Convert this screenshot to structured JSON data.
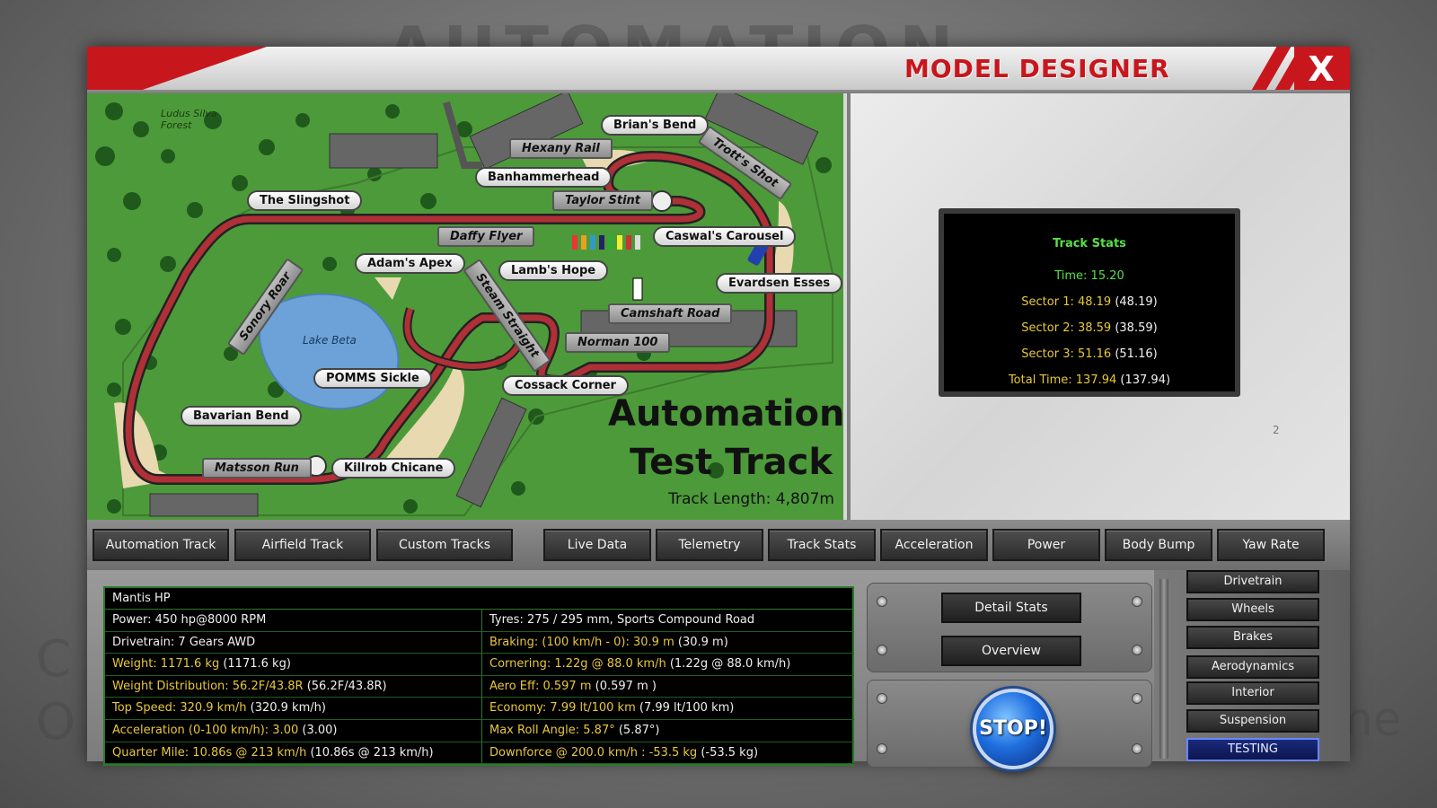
{
  "window": {
    "title": "MODEL DESIGNER",
    "close_label": "X"
  },
  "map": {
    "title_line1": "Automation",
    "title_line2": "Test Track",
    "length": "Track Length: 4,807m",
    "lake": "Lake Beta",
    "forest": "Ludus Silva Forest",
    "corners": [
      "Brian's Bend",
      "Hexany Rail",
      "Banhammerhead",
      "Trott's Shot",
      "The Slingshot",
      "Taylor Stint",
      "Caswal's Carousel",
      "Daffy Flyer",
      "Adam's Apex",
      "Lamb's Hope",
      "Evardsen Esses",
      "Sonory Roar",
      "Steam Straight",
      "Camshaft Road",
      "Norman 100",
      "Lake Beta",
      "POMMS Sickle",
      "Cossack Corner",
      "Bavarian Bend",
      "Matsson Run",
      "Killrob Chicane"
    ]
  },
  "track_stats": {
    "title": "Track Stats",
    "time_label": "Time: 15.20",
    "sector1": "Sector 1: 48.19",
    "sector1_best": "(48.19)",
    "sector2": "Sector 2: 38.59",
    "sector2_best": "(38.59)",
    "sector3": "Sector 3: 51.16",
    "sector3_best": "(51.16)",
    "total": "Total Time: 137.94",
    "total_best": "(137.94)",
    "page": "2"
  },
  "track_tabs": [
    "Automation Track",
    "Airfield Track",
    "Custom Tracks"
  ],
  "data_tabs": [
    "Live Data",
    "Telemetry",
    "Track Stats",
    "Acceleration",
    "Power",
    "Body Bump",
    "Yaw Rate"
  ],
  "car": {
    "name": "Mantis HP",
    "left": [
      {
        "label": "Power: 450 hp@8000 RPM",
        "extra": ""
      },
      {
        "label": "Drivetrain: 7 Gears AWD",
        "extra": ""
      },
      {
        "label": "Weight: 1171.6 kg",
        "extra": "(1171.6 kg)"
      },
      {
        "label": "Weight Distribution: 56.2F/43.8R",
        "extra": "(56.2F/43.8R)"
      },
      {
        "label": "Top Speed: 320.9 km/h",
        "extra": "(320.9 km/h)"
      },
      {
        "label": "Acceleration (0-100 km/h): 3.00",
        "extra": "(3.00)"
      },
      {
        "label": "Quarter Mile: 10.86s @ 213 km/h",
        "extra": "(10.86s @ 213 km/h)"
      }
    ],
    "right": [
      {
        "label": "Tyres: 275 / 295 mm, Sports Compound Road",
        "extra": ""
      },
      {
        "label": "Braking: (100 km/h - 0): 30.9 m",
        "extra": "(30.9 m)"
      },
      {
        "label": "Cornering: 1.22g @ 88.0 km/h",
        "extra": "(1.22g @ 88.0 km/h)"
      },
      {
        "label": "Aero Eff: 0.597 m",
        "extra": "(0.597 m )"
      },
      {
        "label": "Economy: 7.99 lt/100 km",
        "extra": "(7.99 lt/100 km)"
      },
      {
        "label": "Max Roll Angle: 5.87°",
        "extra": "(5.87°)"
      },
      {
        "label": "Downforce @ 200.0 km/h : -53.5 kg",
        "extra": "(-53.5 kg)"
      }
    ]
  },
  "buttons": {
    "detail_stats": "Detail Stats",
    "overview": "Overview",
    "stop": "STOP!"
  },
  "side_menu": [
    "Drivetrain",
    "Wheels",
    "Brakes",
    "Aerodynamics",
    "Interior",
    "Suspension",
    "TESTING"
  ],
  "colors": {
    "accent_red": "#c8161d",
    "stat_green": "#56e044",
    "stat_yellow": "#e8c83a",
    "grass": "#4d9a3a"
  }
}
